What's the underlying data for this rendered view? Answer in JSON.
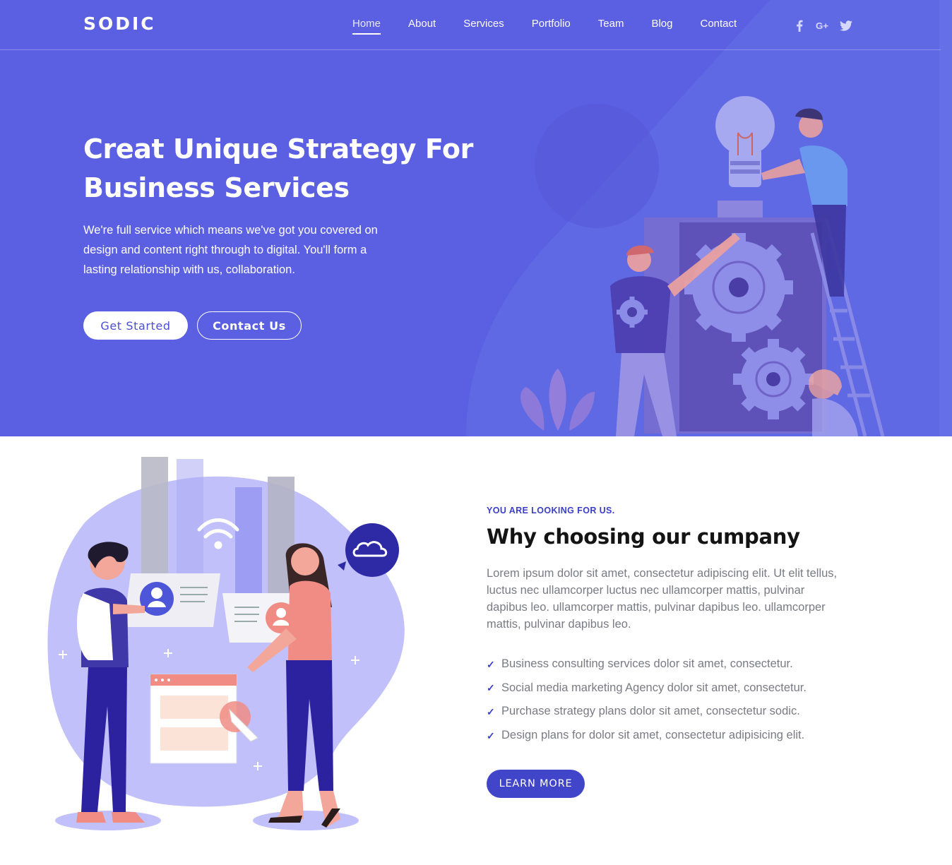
{
  "header": {
    "logo": "SODIC",
    "nav": [
      {
        "label": "Home",
        "active": true
      },
      {
        "label": "About"
      },
      {
        "label": "Services"
      },
      {
        "label": "Portfolio"
      },
      {
        "label": "Team"
      },
      {
        "label": "Blog"
      },
      {
        "label": "Contact"
      }
    ],
    "social": [
      {
        "icon": "facebook-icon",
        "glyph": "f"
      },
      {
        "icon": "google-plus-icon",
        "glyph": "G+"
      },
      {
        "icon": "twitter-icon",
        "glyph": "twitter"
      }
    ]
  },
  "hero": {
    "title_line1": "Creat Unique Strategy For",
    "title_line2": "Business Services",
    "text": "We're full service which means we've got you covered on design and content right through to digital. You'll form a lasting relationship with us, collaboration.",
    "primary_button": "Get Started",
    "secondary_button": "Contact Us"
  },
  "about": {
    "eyebrow": "YOU ARE LOOKING FOR US.",
    "title": "Why choosing our cumpany",
    "text": "Lorem ipsum dolor sit amet, consectetur adipiscing elit. Ut elit tellus, luctus nec ullamcorper luctus nec ullamcorper mattis, pulvinar dapibus leo. ullamcorper mattis, pulvinar dapibus leo. ullamcorper mattis, pulvinar dapibus leo.",
    "features": [
      "Business consulting services dolor sit amet, consectetur.",
      "Social media marketing Agency dolor sit amet, consectetur.",
      "Purchase strategy plans dolor sit amet, consectetur sodic.",
      "Design plans for dolor sit amet, consectetur adipisicing elit."
    ],
    "button": "LEARN MORE"
  },
  "colors": {
    "hero_bg": "#5b5fe2",
    "accent": "#4145c9",
    "body_text": "#7a7a84"
  }
}
